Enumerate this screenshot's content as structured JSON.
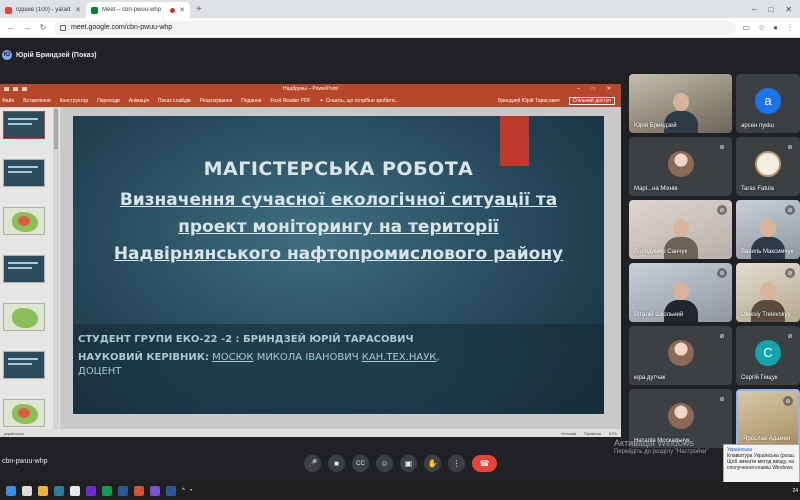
{
  "browser": {
    "tabs": [
      {
        "label": "одшие (100) - yarad1964@...",
        "close": "✕",
        "active": false
      },
      {
        "label": "Meet – cbn-pwuu-whp",
        "close": "✕",
        "active": true
      }
    ],
    "new_tab": "+",
    "window_controls": [
      "–",
      "□",
      "✕"
    ],
    "nav": {
      "back": "←",
      "forward": "→",
      "reload": "↻"
    },
    "url": "meet.google.com/cbn-pwuu-whp"
  },
  "meet": {
    "presenter_initial": "Ю",
    "presenter_label": "Юрій Бриндзей (Показ)",
    "meeting_code": "cbn-pwuu-whp",
    "controls": [
      {
        "name": "mic-button",
        "icon": "🎤"
      },
      {
        "name": "camera-button",
        "icon": "■"
      },
      {
        "name": "captions-button",
        "icon": "CC"
      },
      {
        "name": "reactions-button",
        "icon": "☺"
      },
      {
        "name": "present-button",
        "icon": "▣"
      },
      {
        "name": "raise-hand-button",
        "icon": "✋"
      },
      {
        "name": "more-options-button",
        "icon": "⋮"
      }
    ],
    "end_call_icon": "☎"
  },
  "powerpoint": {
    "doc_title": "Надбруны – PowerPoint",
    "ribbon_tabs": [
      "Файл",
      "Вставлення",
      "Конструктор",
      "Переходи",
      "Анімація",
      "Показ слайдів",
      "Рецензування",
      "Подання",
      "Foxit Reader PDF"
    ],
    "search_text": "Скажіть, що потрібно зробити...",
    "user_name": "Бриндзей Юрій Тарасович",
    "share_label": "Спільний доступ",
    "status_left": "українська",
    "status_right": [
      "Нотатки",
      "Примітки"
    ],
    "zoom": "57%"
  },
  "slide": {
    "title": "МАГІСТЕРСЬКА РОБОТА",
    "subtitle_lines": [
      "Визначення сучасної екологічної ситуації та",
      "проект моніторингу на території",
      "Надвірнянського нафтопромислового району"
    ],
    "student_line": "СТУДЕНТ ГРУПИ ЕКО-22 -2 : БРИНДЗЕЙ ЮРІЙ ТАРАСОВИЧ",
    "supervisor_label": "НАУКОВИЙ КЕРІВНИК:",
    "supervisor_surname": "МОСЮК",
    "supervisor_name": "МИКОЛА ІВАНОВИЧ",
    "supervisor_degree": "КАН.ТЕХ.НАУК",
    "supervisor_rank": "ДОЦЕНТ"
  },
  "participants": [
    {
      "name": "Юрій Бриндзей",
      "muted": false,
      "kind": "video"
    },
    {
      "name": "арсен пукіш",
      "muted": false,
      "kind": "letter",
      "letter": "а",
      "color": "#1a73e8"
    },
    {
      "name": "Марі...на Міхнів",
      "muted": true,
      "kind": "photo"
    },
    {
      "name": "Taras Fatula",
      "muted": true,
      "kind": "seal"
    },
    {
      "name": "Володимир Санчук",
      "muted": true,
      "kind": "video2"
    },
    {
      "name": "Василь Максимчук",
      "muted": true,
      "kind": "video3"
    },
    {
      "name": "Віталій Школьний",
      "muted": true,
      "kind": "video3"
    },
    {
      "name": "Oleksiy Trelevskyy",
      "muted": true,
      "kind": "video4"
    },
    {
      "name": "юра дутчак",
      "muted": true,
      "kind": "photo"
    },
    {
      "name": "Сергій Гищук",
      "muted": true,
      "kind": "letter",
      "letter": "С",
      "color": "#12a4af"
    },
    {
      "name": "Наталія Москальчук",
      "muted": true,
      "kind": "photo"
    },
    {
      "name": "Ярослав Адамен",
      "muted": true,
      "kind": "video5"
    }
  ],
  "watermark": {
    "line1": "Активація Windows",
    "line2": "Перейдіть до розділу \"Настройки\""
  },
  "lang_popup": {
    "lines": [
      "Українська",
      "Клавіатура Українська (розш.",
      "Щоб змінити метод вводу, на",
      "сполучення клавіш Windows"
    ]
  },
  "taskbar": {
    "clock": "24"
  },
  "colors": {
    "meet_bg": "#202124",
    "ppt_accent": "#b7472a",
    "end_call": "#ea4335"
  }
}
